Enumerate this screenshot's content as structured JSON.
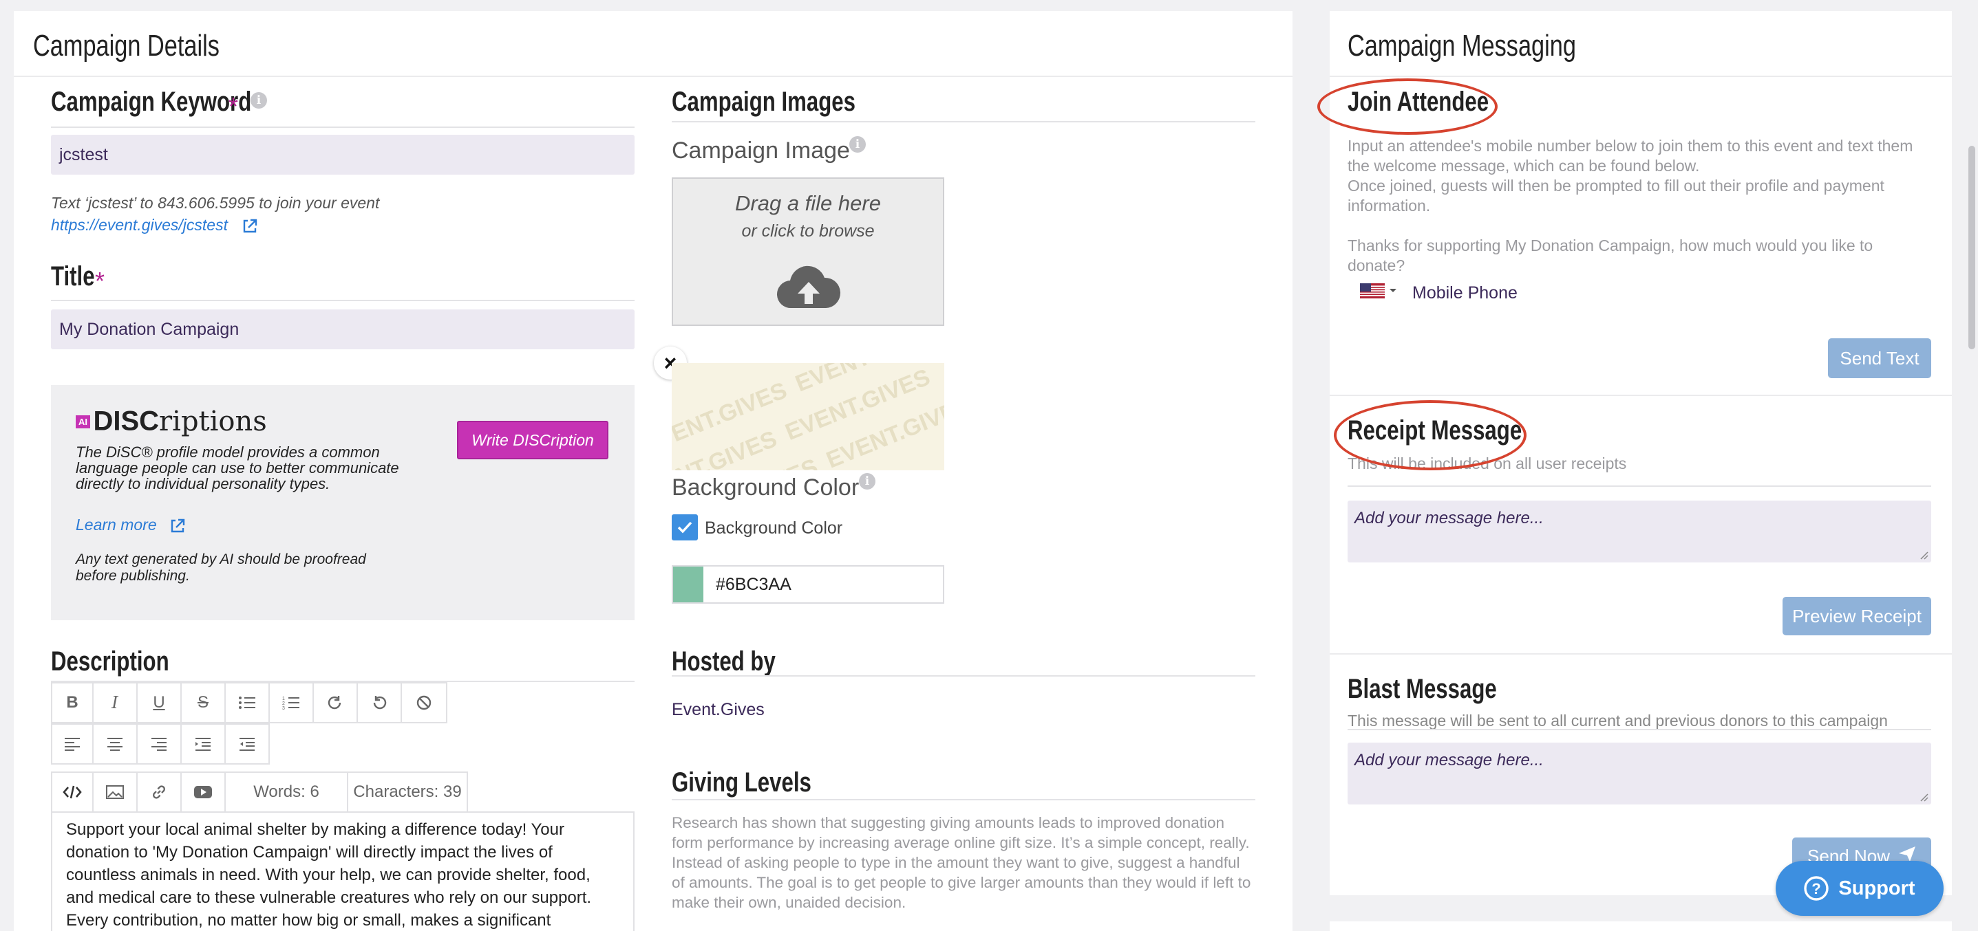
{
  "campaign_details": {
    "panel_title": "Campaign Details",
    "keyword": {
      "label": "Campaign Keyword",
      "required_mark": "*",
      "value": "jcstest",
      "hint": "Text ‘jcstest’ to 843.606.5995 to join your event",
      "url": "https://event.gives/jcstest"
    },
    "title": {
      "label": "Title",
      "required_mark": "*",
      "value": "My Donation Campaign"
    },
    "discriptions": {
      "ai_badge": "AI",
      "logo_bold": "DISC",
      "logo_rest": "riptions",
      "description": "The DiSC® profile model provides a common language people can use to better communicate directly to individual personality types.",
      "learn_more": "Learn more",
      "disclaimer": "Any text generated by AI should be proofread before publishing.",
      "write_button": "Write DISCription"
    },
    "description": {
      "label": "Description",
      "words": "Words: 6",
      "characters": "Characters: 39",
      "body": "Support your local animal shelter by making a difference today! Your donation to 'My Donation Campaign' will directly impact the lives of countless animals in need. With your help, we can provide shelter, food, and medical care to these vulnerable creatures who rely on our support. Every contribution, no matter how big or small, makes a significant difference in the lives of these animals. Your generosity will not only"
    }
  },
  "campaign_images": {
    "label": "Campaign Images",
    "image_label": "Campaign Image",
    "drop_title": "Drag a file here",
    "drop_sub": "or click to browse",
    "close_glyph": "×",
    "watermark": "EVENT.GIVES",
    "bg_color_label": "Background Color",
    "bg_color_checkbox_label": "Background Color",
    "bg_color_checked": true,
    "bg_color_value": "#6BC3AA",
    "swatch_color": "#7fc1a4"
  },
  "hosted_by": {
    "label": "Hosted by",
    "value": "Event.Gives"
  },
  "giving_levels": {
    "label": "Giving Levels",
    "text": "Research has shown that suggesting giving amounts leads to improved donation form performance by increasing average online gift size. It’s a simple concept, really. Instead of asking people to type in the amount they want to give, suggest a handful of amounts. The goal is to get people to give larger amounts than they would if left to make their own, unaided decision."
  },
  "campaign_messaging": {
    "panel_title": "Campaign Messaging",
    "join_attendee": {
      "label": "Join Attendee",
      "line1": "Input an attendee's mobile number below to join them to this event and text them the welcome message, which can be found below.",
      "line2": "Once joined, guests will then be prompted to fill out their profile and payment information.",
      "line3": "Thanks for supporting My Donation Campaign, how much would you like to donate?",
      "phone_placeholder": "Mobile Phone",
      "send_button": "Send Text"
    },
    "receipt": {
      "label": "Receipt Message",
      "hint": "This will be included on all user receipts",
      "placeholder": "Add your message here...",
      "preview_button": "Preview Receipt"
    },
    "blast": {
      "label": "Blast Message",
      "hint": "This message will be sent to all current and previous donors to this campaign",
      "placeholder": "Add your message here...",
      "send_button": "Send Now"
    }
  },
  "support_button": "Support",
  "colors": {
    "accent_purple": "#c632b4",
    "annotation_red": "#d6432f",
    "button_blue": "#8fb2d9",
    "support_blue": "#3d8fe0",
    "link_blue": "#2b7bd6",
    "checkbox_blue": "#3d8fe0"
  }
}
